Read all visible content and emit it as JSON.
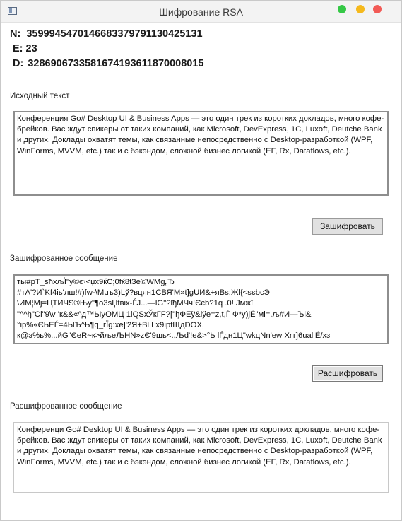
{
  "window": {
    "title": "Шифрование RSA"
  },
  "keys": {
    "n_label": "N:",
    "n_value": "3599945470146683379791130425131",
    "e_label": "E:",
    "e_value": "23",
    "d_label": "D:",
    "d_value": "3286906733581674193611870008015"
  },
  "source": {
    "label": "Исходный текст",
    "text": "Конференция Go# Desktop UI & Business Apps — это один трек из коротких докладов, много кофе-брейков. Вас ждут спикеры от таких компаний, как Microsoft, DevExpress, 1C, Luxoft, Deutche Bank и других. Доклады охватят темы, как связанные непосредственно с Desktop-разработкой (WPF, WinForms, MVVM, etc.) так и с бэкэндом, сложной бизнес логикой (EF, Rx, Dataflows, etc.)."
  },
  "encrypt_button": "Зашифровать",
  "encrypted": {
    "label": "Зашифрованное сообщение",
    "lines": [
      "ты#рТ_sħхљЇ\"у©є›<џх9ќС;0fќ8t3e©WMg„Ђ",
      "#тА'?И`Kf4іь'лш!#)fw-\\Мμъ3)Lў?вцян1СВЯ'М»t]gUИ&+яBs:Жl{<sєbсЭ",
      "\\ИМ¦Мј=ЦТИЧЅ®Њу\"¶о3sЏtвіх-ЃЈ...—lG\"?lђМЧч!Єєb?1q .0!.Јмжї",
      "\"^^ђ\"Cl\"9\\v 'к&&«^д™ЫуОМЦ 1lQSxЎкГF?[\"ђФЕў&іўе=z,t,Ѓ     Ф*у)jЁ\"мl=.љ#И—Ъl&",
      "°ір%«ЄЬЕЃ=4ЫЪ^Ь¶q_гЇg:xе]'2Я+Bl Lx9ірfЩдDOX,",
      "к@э%ь%...йG\"ЄеR~к>йљеЉНN»zЄ'9шь<.,Љd'!е&>°Ь lЃдн1Ц\"wkцNn'еw Xrт]6uаllЁ/хз"
    ]
  },
  "decrypt_button": "Расшифровать",
  "decrypted": {
    "label": "Расшифрованное сообщение",
    "text": "Конференци Go# Desktop UI & Business Apps — это один трек из коротких докладов, много кофе-брейков. Вас ждут спикеры от таких компаний, как Microsoft, DevExpress, 1C, Luxoft, Deutche Bank и других. Доклады охватят темы, как связанные непосредственно с Desktop-разработкой (WPF, WinForms, MVVM, etc.) так и с бэкэндом, сложной бизнес логикой (EF, Rx, Dataflows, etc.)."
  },
  "colors": {
    "close": "#f25a56",
    "minimize": "#35c846",
    "maximize": "#f5b91c"
  }
}
